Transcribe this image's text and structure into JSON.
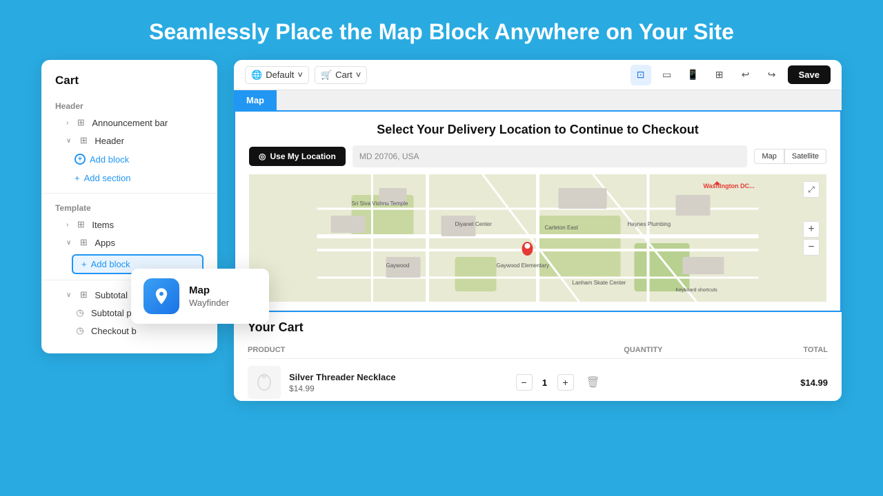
{
  "page": {
    "title": "Seamlessly Place the Map Block Anywhere on Your Site",
    "bg_color": "#29abe2"
  },
  "toolbar": {
    "default_label": "Default",
    "cart_label": "Cart",
    "save_label": "Save"
  },
  "cart_panel": {
    "title": "Cart",
    "sections": {
      "header_label": "Header",
      "announcement_bar": "Announcement bar",
      "header": "Header",
      "add_block": "Add block",
      "add_section": "Add section",
      "template_label": "Template",
      "items": "Items",
      "apps": "Apps",
      "add_block2": "Add block",
      "subtotal_label": "Subtotal",
      "subtotal_price": "Subtotal pri",
      "checkout_btn": "Checkout b"
    }
  },
  "tooltip": {
    "name": "Map",
    "subtitle": "Wayfinder"
  },
  "map_section": {
    "tab": "Map",
    "title": "Select Your Delivery Location to Continue to Checkout",
    "use_location_btn": "Use My Location",
    "address": "MD 20706, USA",
    "map_type_map": "Map",
    "map_type_satellite": "Satellite",
    "fullscreen": "⤢"
  },
  "cart_section": {
    "title": "our Cart",
    "table": {
      "col_product": "PRODUCT",
      "col_quantity": "QUANTITY",
      "col_total": "TOTAL"
    },
    "item": {
      "name": "Silver Threader Necklace",
      "price": "$14.99",
      "quantity": "1",
      "total": "$14.99"
    }
  },
  "icons": {
    "chevron_right": "›",
    "chevron_down": "˅",
    "globe": "🌐",
    "cart": "🛒",
    "desktop": "🖥",
    "mobile": "📱",
    "tablet": "⬜",
    "fit_width": "⊞",
    "undo": "↩",
    "redo": "↪",
    "pin": "📍",
    "location_dot": "◉",
    "zoom_in": "+",
    "zoom_out": "−",
    "minus": "−",
    "plus": "+",
    "trash": "🗑",
    "plus_circle": "+"
  }
}
